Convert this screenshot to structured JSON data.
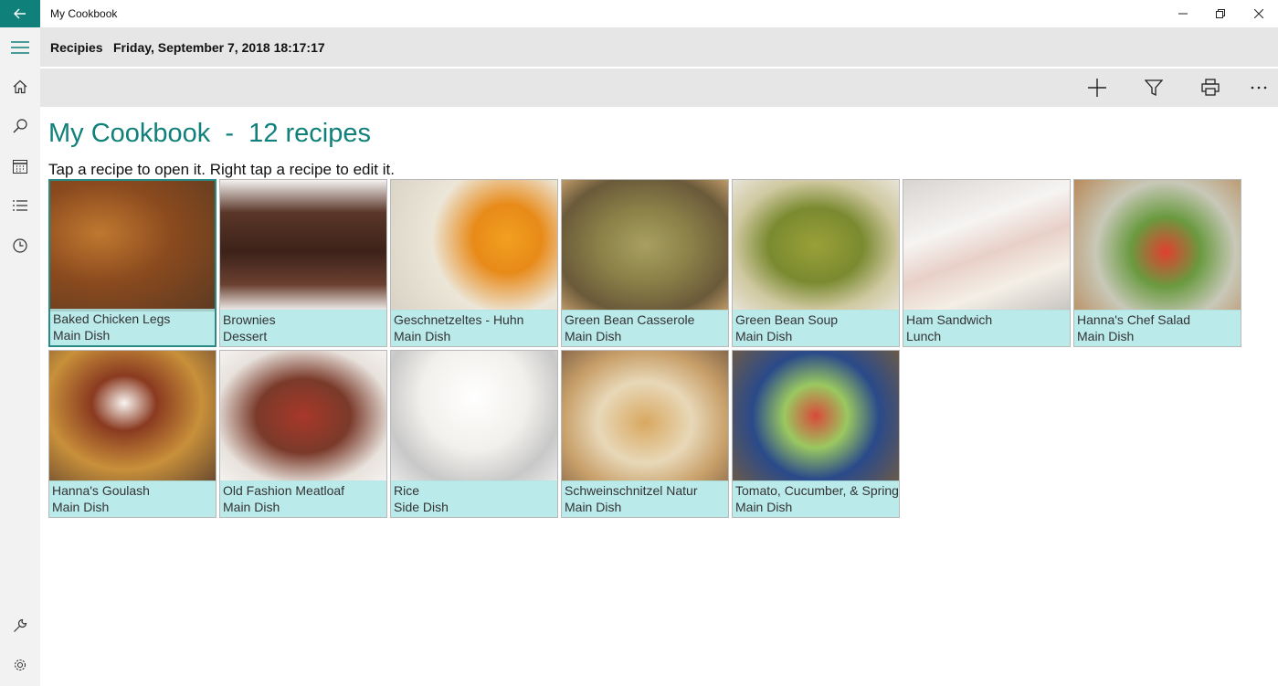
{
  "window": {
    "title": "My Cookbook"
  },
  "header": {
    "title": "Recipies",
    "datetime": "Friday, September 7, 2018 18:17:17"
  },
  "page": {
    "heading": "My Cookbook  -  12 recipes",
    "instructions": "Tap a recipe to open it. Right tap a recipe to edit it."
  },
  "colors": {
    "accent": "#10807a",
    "caption_bg": "#afe6e8",
    "rail_bg": "#f2f2f2",
    "header_bg": "#e6e6e6"
  },
  "recipes": [
    {
      "name": "Baked Chicken Legs",
      "category": "Main Dish"
    },
    {
      "name": "Brownies",
      "category": "Dessert"
    },
    {
      "name": "Geschnetzeltes - Huhn",
      "category": "Main Dish"
    },
    {
      "name": "Green Bean Casserole",
      "category": "Main Dish"
    },
    {
      "name": "Green Bean Soup",
      "category": "Main Dish"
    },
    {
      "name": "Ham Sandwich",
      "category": "Lunch"
    },
    {
      "name": "Hanna's Chef Salad",
      "category": "Main Dish"
    },
    {
      "name": "Hanna's Goulash",
      "category": "Main Dish"
    },
    {
      "name": "Old Fashion Meatloaf",
      "category": "Main Dish"
    },
    {
      "name": "Rice",
      "category": "Side Dish"
    },
    {
      "name": "Schweinschnitzel Natur",
      "category": "Main Dish"
    },
    {
      "name": "Tomato, Cucumber, & Spring",
      "category": "Main Dish"
    }
  ]
}
